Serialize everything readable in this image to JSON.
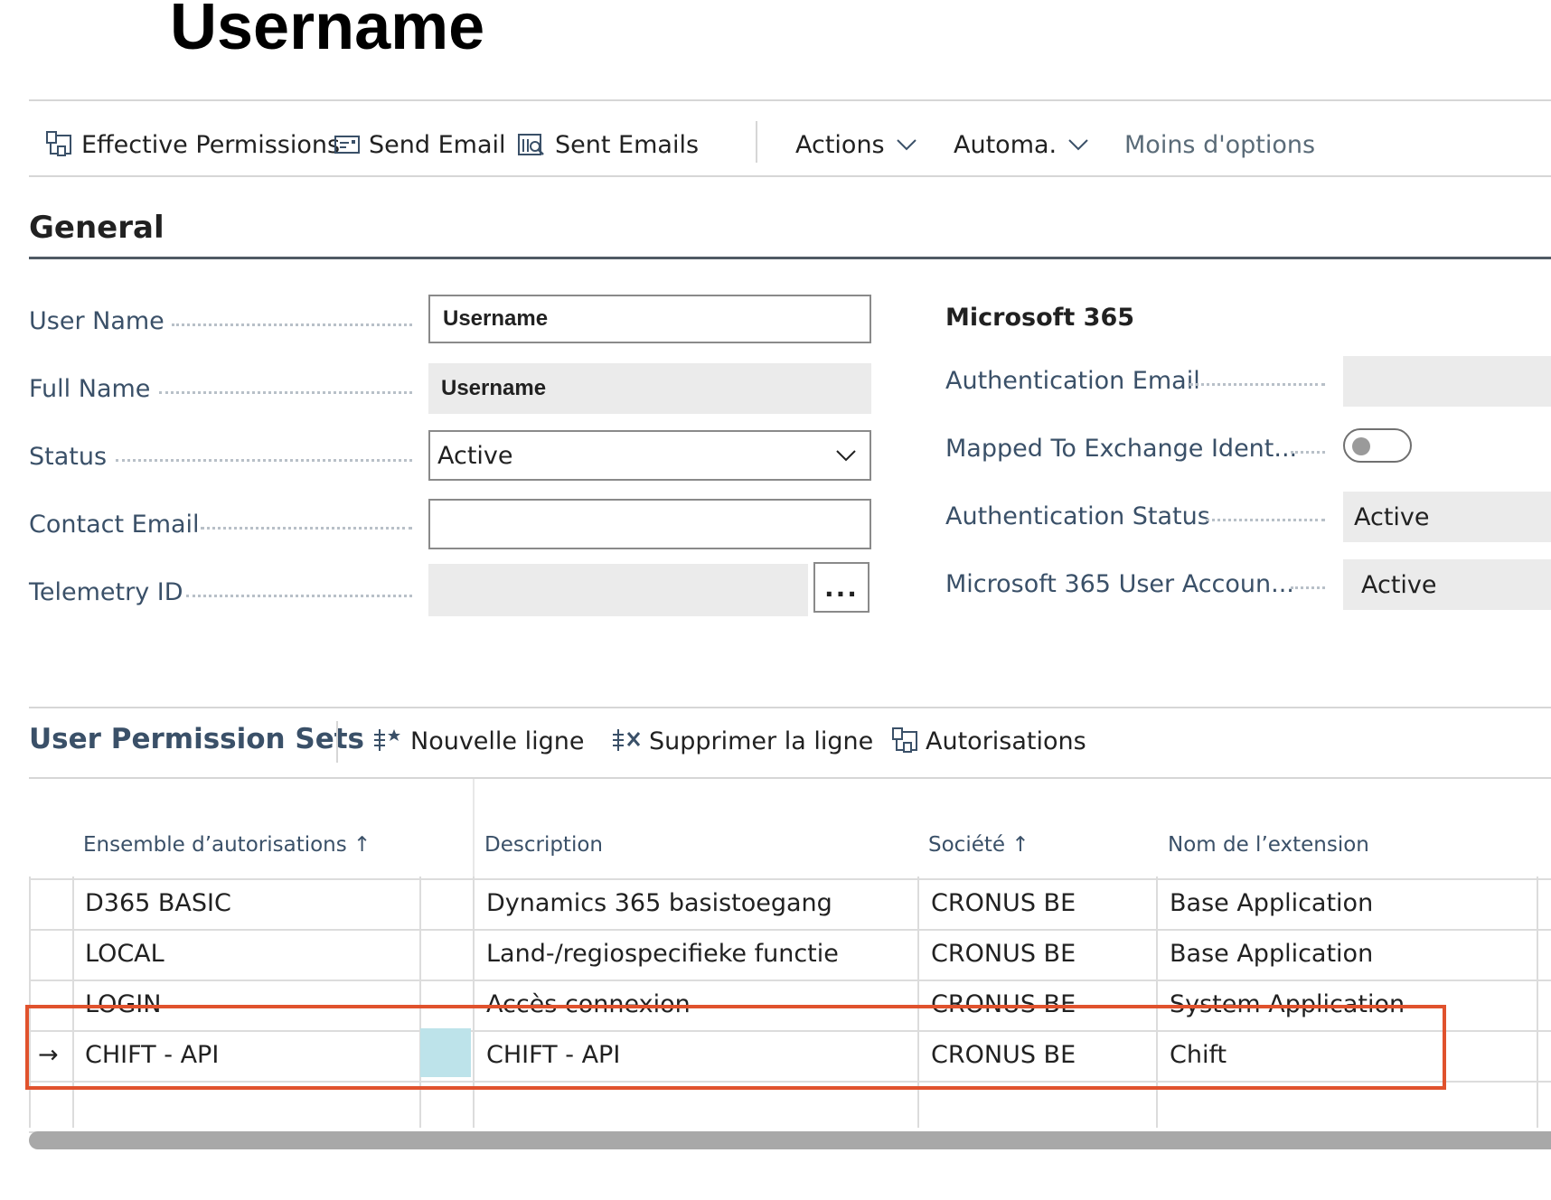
{
  "page": {
    "title": "Username"
  },
  "toolbar": {
    "effective_permissions": "Effective Permissions",
    "send_email": "Send Email",
    "sent_emails": "Sent Emails",
    "actions": "Actions",
    "automate": "Automa.",
    "less_options": "Moins d'options"
  },
  "general": {
    "title": "General",
    "fields": {
      "user_name": {
        "label": "User Name",
        "value": "Username"
      },
      "full_name": {
        "label": "Full Name",
        "value": "Username"
      },
      "status": {
        "label": "Status",
        "value": "Active"
      },
      "contact_email": {
        "label": "Contact Email",
        "value": ""
      },
      "telemetry_id": {
        "label": "Telemetry ID",
        "value": "",
        "assist": "..."
      }
    },
    "microsoft365": {
      "title": "Microsoft 365",
      "auth_email": {
        "label": "Authentication Email",
        "value": ""
      },
      "mapped_exchange": {
        "label": "Mapped To Exchange Ident...",
        "value": false
      },
      "auth_status": {
        "label": "Authentication Status",
        "value": "Active"
      },
      "m365_account": {
        "label": "Microsoft 365 User Accoun...",
        "value": "Active"
      }
    }
  },
  "permission_sets": {
    "title": "User Permission Sets",
    "actions": {
      "new_line": "Nouvelle ligne",
      "delete_line": "Supprimer la ligne",
      "permissions": "Autorisations"
    },
    "columns": {
      "set": "Ensemble d’autorisations",
      "description": "Description",
      "company": "Société",
      "extension": "Nom de l’extension"
    },
    "rows": [
      {
        "set": "D365 BASIC",
        "description": "Dynamics 365 basistoegang",
        "company": "CRONUS BE",
        "extension": "Base Application"
      },
      {
        "set": "LOCAL",
        "description": "Land-/regiospecifieke functie",
        "company": "CRONUS BE",
        "extension": "Base Application"
      },
      {
        "set": "LOGIN",
        "description": "Accès connexion",
        "company": "CRONUS BE",
        "extension": "System Application"
      },
      {
        "set": "CHIFT - API",
        "description": "CHIFT - API",
        "company": "CRONUS BE",
        "extension": "Chift"
      }
    ],
    "current_row_marker": "→",
    "sort_indicator": "↑"
  },
  "colors": {
    "highlight": "#e0522d",
    "selected_cell": "#bde3ea",
    "label": "#3a5068"
  }
}
